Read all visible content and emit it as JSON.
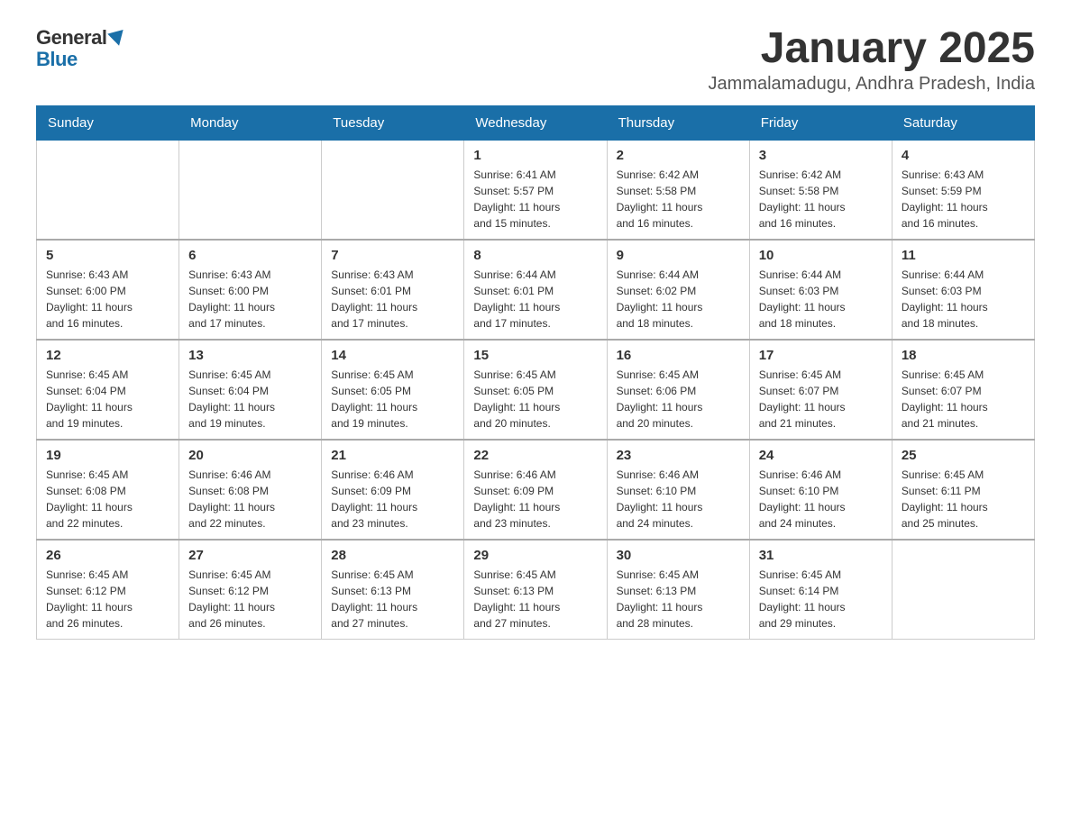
{
  "header": {
    "logo_general": "General",
    "logo_blue": "Blue",
    "month_title": "January 2025",
    "location": "Jammalamadugu, Andhra Pradesh, India"
  },
  "days_of_week": [
    "Sunday",
    "Monday",
    "Tuesday",
    "Wednesday",
    "Thursday",
    "Friday",
    "Saturday"
  ],
  "weeks": [
    [
      {
        "day": "",
        "info": ""
      },
      {
        "day": "",
        "info": ""
      },
      {
        "day": "",
        "info": ""
      },
      {
        "day": "1",
        "info": "Sunrise: 6:41 AM\nSunset: 5:57 PM\nDaylight: 11 hours\nand 15 minutes."
      },
      {
        "day": "2",
        "info": "Sunrise: 6:42 AM\nSunset: 5:58 PM\nDaylight: 11 hours\nand 16 minutes."
      },
      {
        "day": "3",
        "info": "Sunrise: 6:42 AM\nSunset: 5:58 PM\nDaylight: 11 hours\nand 16 minutes."
      },
      {
        "day": "4",
        "info": "Sunrise: 6:43 AM\nSunset: 5:59 PM\nDaylight: 11 hours\nand 16 minutes."
      }
    ],
    [
      {
        "day": "5",
        "info": "Sunrise: 6:43 AM\nSunset: 6:00 PM\nDaylight: 11 hours\nand 16 minutes."
      },
      {
        "day": "6",
        "info": "Sunrise: 6:43 AM\nSunset: 6:00 PM\nDaylight: 11 hours\nand 17 minutes."
      },
      {
        "day": "7",
        "info": "Sunrise: 6:43 AM\nSunset: 6:01 PM\nDaylight: 11 hours\nand 17 minutes."
      },
      {
        "day": "8",
        "info": "Sunrise: 6:44 AM\nSunset: 6:01 PM\nDaylight: 11 hours\nand 17 minutes."
      },
      {
        "day": "9",
        "info": "Sunrise: 6:44 AM\nSunset: 6:02 PM\nDaylight: 11 hours\nand 18 minutes."
      },
      {
        "day": "10",
        "info": "Sunrise: 6:44 AM\nSunset: 6:03 PM\nDaylight: 11 hours\nand 18 minutes."
      },
      {
        "day": "11",
        "info": "Sunrise: 6:44 AM\nSunset: 6:03 PM\nDaylight: 11 hours\nand 18 minutes."
      }
    ],
    [
      {
        "day": "12",
        "info": "Sunrise: 6:45 AM\nSunset: 6:04 PM\nDaylight: 11 hours\nand 19 minutes."
      },
      {
        "day": "13",
        "info": "Sunrise: 6:45 AM\nSunset: 6:04 PM\nDaylight: 11 hours\nand 19 minutes."
      },
      {
        "day": "14",
        "info": "Sunrise: 6:45 AM\nSunset: 6:05 PM\nDaylight: 11 hours\nand 19 minutes."
      },
      {
        "day": "15",
        "info": "Sunrise: 6:45 AM\nSunset: 6:05 PM\nDaylight: 11 hours\nand 20 minutes."
      },
      {
        "day": "16",
        "info": "Sunrise: 6:45 AM\nSunset: 6:06 PM\nDaylight: 11 hours\nand 20 minutes."
      },
      {
        "day": "17",
        "info": "Sunrise: 6:45 AM\nSunset: 6:07 PM\nDaylight: 11 hours\nand 21 minutes."
      },
      {
        "day": "18",
        "info": "Sunrise: 6:45 AM\nSunset: 6:07 PM\nDaylight: 11 hours\nand 21 minutes."
      }
    ],
    [
      {
        "day": "19",
        "info": "Sunrise: 6:45 AM\nSunset: 6:08 PM\nDaylight: 11 hours\nand 22 minutes."
      },
      {
        "day": "20",
        "info": "Sunrise: 6:46 AM\nSunset: 6:08 PM\nDaylight: 11 hours\nand 22 minutes."
      },
      {
        "day": "21",
        "info": "Sunrise: 6:46 AM\nSunset: 6:09 PM\nDaylight: 11 hours\nand 23 minutes."
      },
      {
        "day": "22",
        "info": "Sunrise: 6:46 AM\nSunset: 6:09 PM\nDaylight: 11 hours\nand 23 minutes."
      },
      {
        "day": "23",
        "info": "Sunrise: 6:46 AM\nSunset: 6:10 PM\nDaylight: 11 hours\nand 24 minutes."
      },
      {
        "day": "24",
        "info": "Sunrise: 6:46 AM\nSunset: 6:10 PM\nDaylight: 11 hours\nand 24 minutes."
      },
      {
        "day": "25",
        "info": "Sunrise: 6:45 AM\nSunset: 6:11 PM\nDaylight: 11 hours\nand 25 minutes."
      }
    ],
    [
      {
        "day": "26",
        "info": "Sunrise: 6:45 AM\nSunset: 6:12 PM\nDaylight: 11 hours\nand 26 minutes."
      },
      {
        "day": "27",
        "info": "Sunrise: 6:45 AM\nSunset: 6:12 PM\nDaylight: 11 hours\nand 26 minutes."
      },
      {
        "day": "28",
        "info": "Sunrise: 6:45 AM\nSunset: 6:13 PM\nDaylight: 11 hours\nand 27 minutes."
      },
      {
        "day": "29",
        "info": "Sunrise: 6:45 AM\nSunset: 6:13 PM\nDaylight: 11 hours\nand 27 minutes."
      },
      {
        "day": "30",
        "info": "Sunrise: 6:45 AM\nSunset: 6:13 PM\nDaylight: 11 hours\nand 28 minutes."
      },
      {
        "day": "31",
        "info": "Sunrise: 6:45 AM\nSunset: 6:14 PM\nDaylight: 11 hours\nand 29 minutes."
      },
      {
        "day": "",
        "info": ""
      }
    ]
  ]
}
